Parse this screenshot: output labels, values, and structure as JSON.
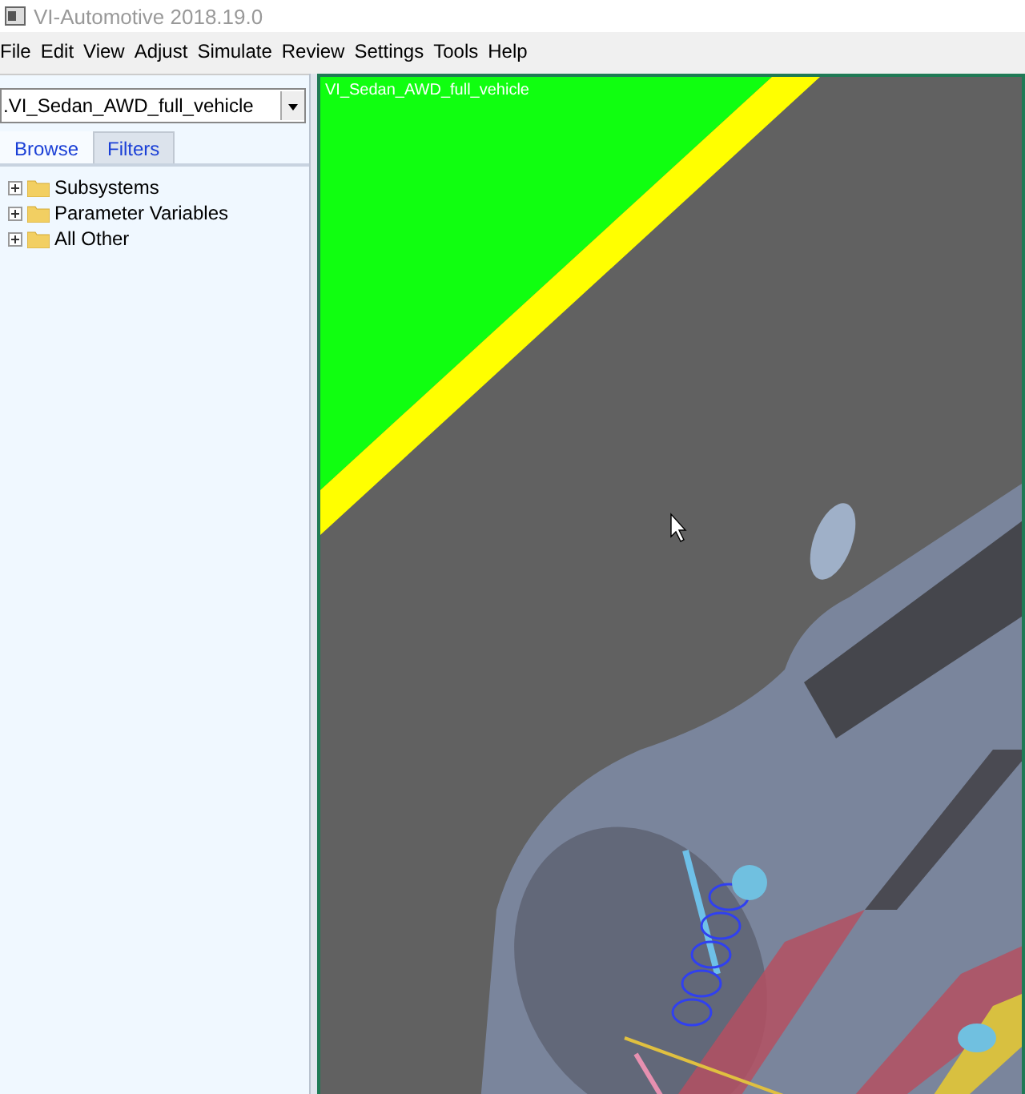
{
  "window": {
    "title": "VI-Automotive 2018.19.0"
  },
  "menu": [
    "File",
    "Edit",
    "View",
    "Adjust",
    "Simulate",
    "Review",
    "Settings",
    "Tools",
    "Help"
  ],
  "model_selector": {
    "value": ".VI_Sedan_AWD_full_vehicle"
  },
  "tabs": [
    {
      "label": "Browse",
      "selected": true
    },
    {
      "label": "Filters",
      "selected": false
    }
  ],
  "tree": [
    {
      "label": "Subsystems",
      "expanded": false
    },
    {
      "label": "Parameter Variables",
      "expanded": false
    },
    {
      "label": "All Other",
      "expanded": false
    }
  ],
  "viewport": {
    "label": "VI_Sedan_AWD_full_vehicle"
  }
}
